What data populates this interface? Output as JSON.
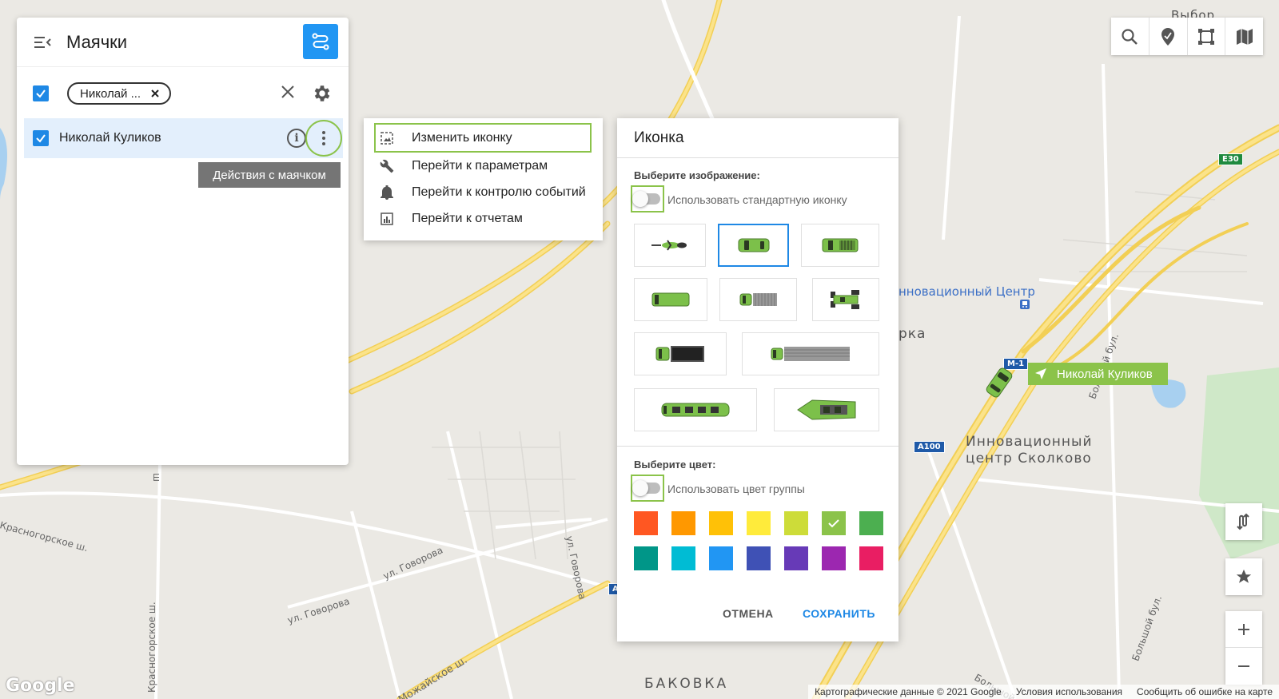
{
  "panel": {
    "title": "Маячки",
    "filter_chip": "Николай ...",
    "item_name": "Николай Куликов",
    "tooltip": "Действия с маячком"
  },
  "context_menu": {
    "items": [
      {
        "label": "Изменить иконку",
        "icon": "image-edit-icon"
      },
      {
        "label": "Перейти к параметрам",
        "icon": "wrench-icon"
      },
      {
        "label": "Перейти к контролю событий",
        "icon": "bell-icon"
      },
      {
        "label": "Перейти к отчетам",
        "icon": "report-chart-icon"
      }
    ]
  },
  "icon_dialog": {
    "title": "Иконка",
    "image_section_label": "Выберите изображение:",
    "use_default_icon_label": "Использовать стандартную иконку",
    "color_section_label": "Выберите цвет:",
    "use_group_color_label": "Использовать цвет группы",
    "cancel_label": "ОТМЕНА",
    "save_label": "СОХРАНИТЬ",
    "icons": [
      "motorcycle",
      "car",
      "pickup",
      "van",
      "small-truck",
      "tractor",
      "truck",
      "long-truck",
      "train",
      "boat"
    ],
    "selected_icon": "car",
    "colors": [
      "#ff5722",
      "#ff9800",
      "#ffc107",
      "#ffeb3b",
      "#cddc39",
      "#8bc34a",
      "#4caf50",
      "#009688",
      "#00bcd4",
      "#2196f3",
      "#3f51b5",
      "#673ab7",
      "#9c27b0",
      "#e91e63"
    ],
    "selected_color": "#8bc34a"
  },
  "map": {
    "vehicle_label": "Николай Куликов",
    "labels": {
      "station": "нновационный Центр",
      "area1": "рка",
      "area2_line1": "Инновационный",
      "area2_line2": "центр Сколково",
      "vybor": "Выбор",
      "bakovka": "БАКОВКА",
      "road_krasnogorskoe1": "Красногорское ш.",
      "road_krasnogorskoe2": "Красногорское ш.",
      "road_govorova1": "ул. Говорова",
      "road_govorova2": "ул. Говорова",
      "road_govorova3": "ул. Говорова",
      "road_mozhaiskoe": "Можайское ш.",
      "road_bolshoi1": "Большой бул.",
      "road_bolshoi2": "Большой бул.",
      "road_bolshoi3": "Большой",
      "road_sh": "ш"
    },
    "badges": {
      "m1": "М-1",
      "a100": "A100",
      "e30": "E30",
      "a": "А"
    },
    "attribution": [
      "Картографические данные © 2021 Google",
      "Условия использования",
      "Сообщить об ошибке на карте"
    ],
    "google": "Google"
  }
}
